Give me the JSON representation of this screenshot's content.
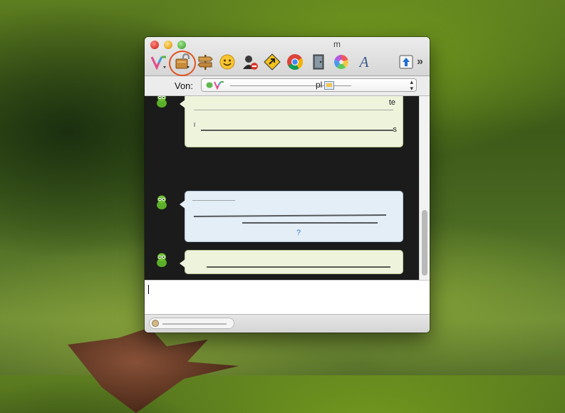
{
  "window": {
    "title": "m"
  },
  "toolbar": {
    "items": [
      {
        "name": "adium-logo",
        "icon": "adium-v-icon"
      },
      {
        "name": "encryption",
        "icon": "lock-icon"
      },
      {
        "name": "signpost",
        "icon": "signpost-icon"
      },
      {
        "name": "emoticons",
        "icon": "smiley-icon"
      },
      {
        "name": "block-contact",
        "icon": "contact-block-icon"
      },
      {
        "name": "link",
        "icon": "link-arrow-icon"
      },
      {
        "name": "chrome",
        "icon": "chrome-icon"
      },
      {
        "name": "door",
        "icon": "door-icon"
      },
      {
        "name": "colors",
        "icon": "color-wheel-icon"
      },
      {
        "name": "font",
        "icon": "font-a-icon",
        "glyph": "A"
      },
      {
        "name": "send-file",
        "icon": "upload-icon"
      }
    ],
    "overflow_glyph": "»"
  },
  "from_row": {
    "label": "Von:",
    "selected_fragment": "pl",
    "chevron": "▴▾"
  },
  "messages": [
    {
      "type": "green",
      "text_fragments": [
        "te",
        "s"
      ]
    },
    {
      "type": "blue",
      "text_fragments": [
        "?"
      ]
    },
    {
      "type": "green",
      "text_fragments": []
    },
    {
      "type": "blue",
      "text_fragments": []
    }
  ],
  "colors": {
    "accent_ring": "#e0531f",
    "chat_background": "#1b1b1b",
    "green_bubble": "#eef3dc",
    "blue_bubble": "#e3eef7",
    "link_highlight": "#f6a21d"
  }
}
